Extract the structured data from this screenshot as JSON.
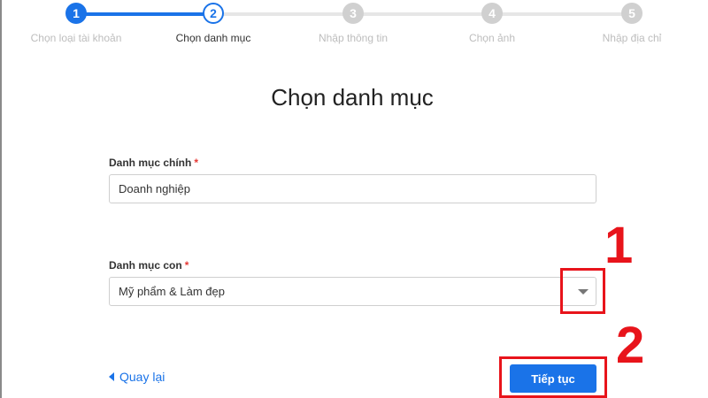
{
  "stepper": {
    "steps": [
      {
        "number": "1",
        "label": "Chọn loại tài khoản"
      },
      {
        "number": "2",
        "label": "Chọn danh mục"
      },
      {
        "number": "3",
        "label": "Nhập thông tin"
      },
      {
        "number": "4",
        "label": "Chọn ảnh"
      },
      {
        "number": "5",
        "label": "Nhập địa chỉ"
      }
    ],
    "current_step": 2
  },
  "page_title": "Chọn danh mục",
  "form": {
    "main_category": {
      "label": "Danh mục chính",
      "required_mark": "*",
      "value": "Doanh nghiệp"
    },
    "sub_category": {
      "label": "Danh mục con",
      "required_mark": "*",
      "value": "Mỹ phẩm & Làm đẹp"
    }
  },
  "actions": {
    "back_label": "Quay lại",
    "continue_label": "Tiếp tục"
  },
  "annotations": {
    "first": "1",
    "second": "2"
  },
  "colors": {
    "accent": "#1a73e8",
    "annotation": "#e8141b",
    "inactive": "#d0d0d0"
  }
}
